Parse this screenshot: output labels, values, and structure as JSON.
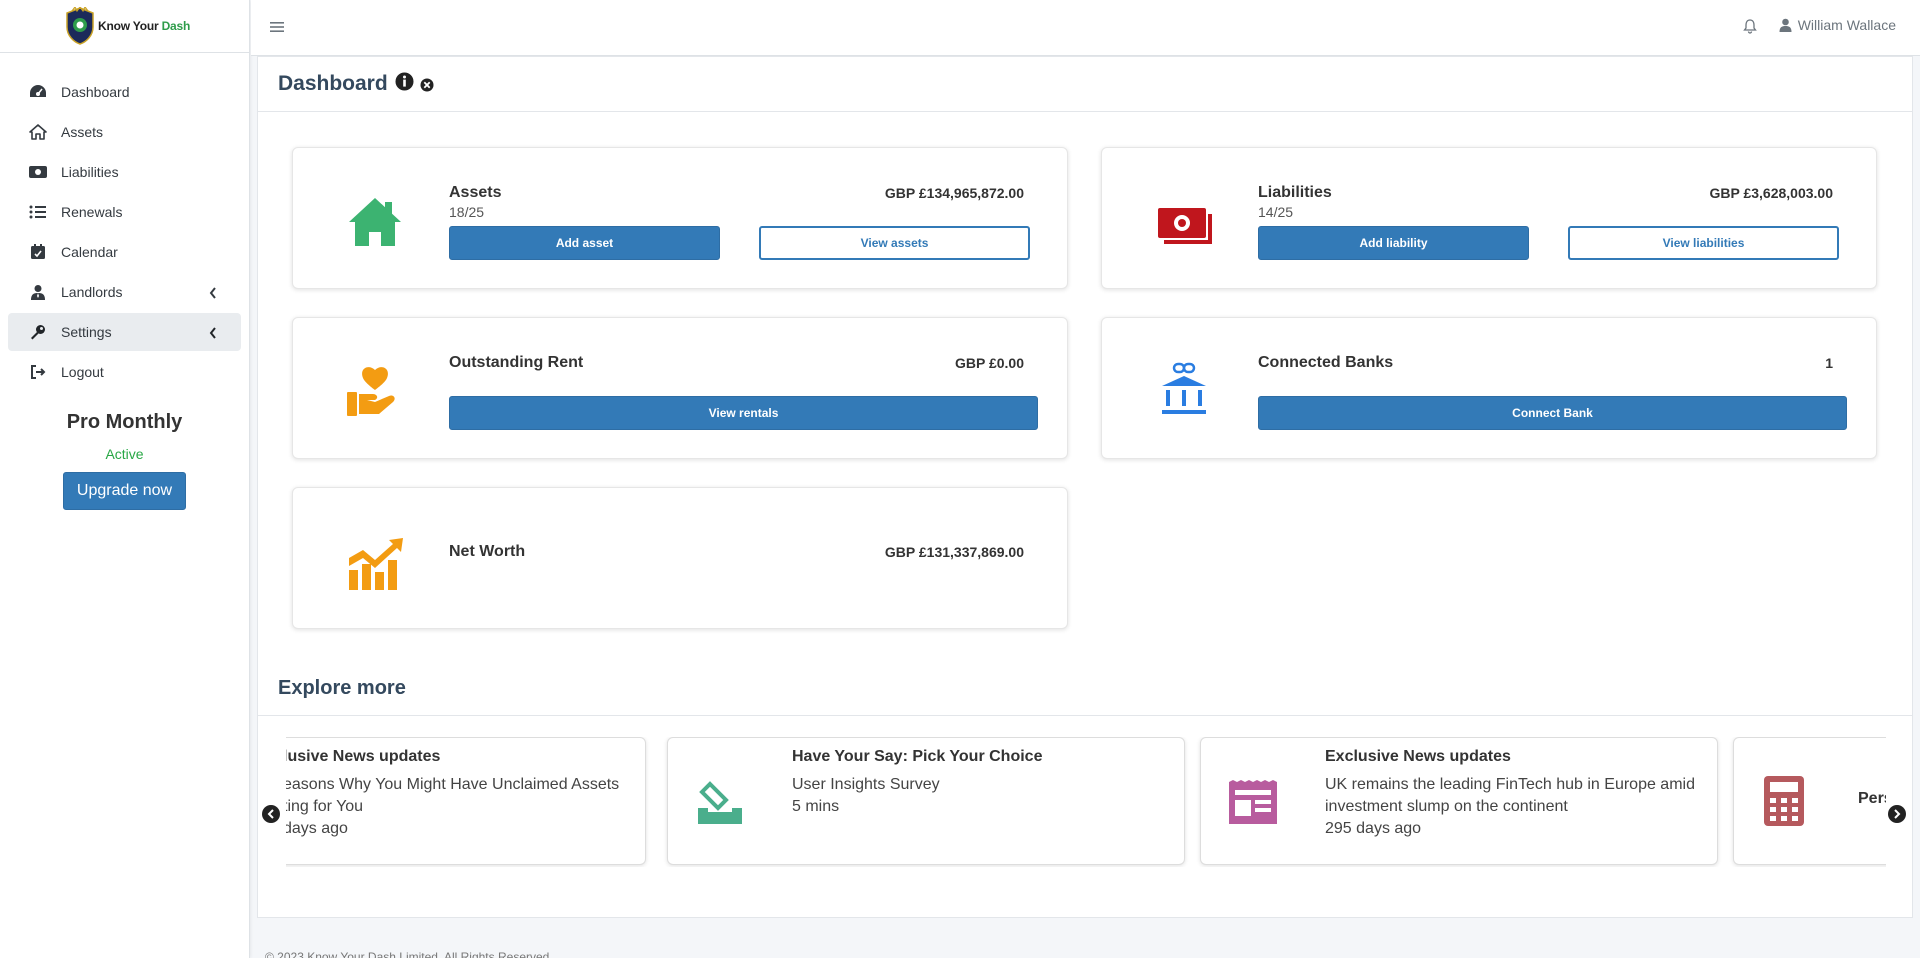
{
  "brand": {
    "name_part1": "Know Your ",
    "name_part2": "Dash"
  },
  "sidebar": {
    "items": [
      {
        "label": "Dashboard",
        "icon": "gauge-icon"
      },
      {
        "label": "Assets",
        "icon": "home-icon"
      },
      {
        "label": "Liabilities",
        "icon": "money-icon"
      },
      {
        "label": "Renewals",
        "icon": "list-icon"
      },
      {
        "label": "Calendar",
        "icon": "calendar-icon"
      },
      {
        "label": "Landlords",
        "icon": "user-tie-icon"
      },
      {
        "label": "Settings",
        "icon": "wrench-icon"
      },
      {
        "label": "Logout",
        "icon": "logout-icon"
      }
    ],
    "plan": {
      "name": "Pro Monthly",
      "status": "Active",
      "upgrade_label": "Upgrade now"
    }
  },
  "header": {
    "user_name": "William Wallace"
  },
  "page": {
    "title": "Dashboard"
  },
  "cards": {
    "assets": {
      "title": "Assets",
      "count": "18/25",
      "amount": "GBP £134,965,872.00",
      "primary_label": "Add asset",
      "secondary_label": "View assets"
    },
    "liabilities": {
      "title": "Liabilities",
      "count": "14/25",
      "amount": "GBP £3,628,003.00",
      "primary_label": "Add liability",
      "secondary_label": "View liabilities"
    },
    "rent": {
      "title": "Outstanding Rent",
      "amount": "GBP £0.00",
      "primary_label": "View rentals"
    },
    "banks": {
      "title": "Connected Banks",
      "amount": "1",
      "primary_label": "Connect Bank"
    },
    "networth": {
      "title": "Net Worth",
      "amount": "GBP £131,337,869.00"
    }
  },
  "colors": {
    "primary": "#337ab7",
    "green": "#3cb371",
    "red": "#c0161d",
    "orange": "#f39c12",
    "blue": "#2a7de1",
    "purple": "#b85c9e",
    "rose": "#b5595d"
  },
  "explore": {
    "title": "Explore more",
    "items": [
      {
        "title": "lusive News updates",
        "line1": "easons Why You Might Have Unclaimed Assets",
        "line2": "ting for You",
        "line3": "days ago"
      },
      {
        "title": "Have Your Say: Pick Your Choice",
        "line1": "User Insights Survey",
        "line2": "5 mins"
      },
      {
        "title": "Exclusive News updates",
        "line1": "UK remains the leading FinTech hub in Europe amid",
        "line2": "investment slump on the continent",
        "line3": "295 days ago"
      },
      {
        "title": "Pers"
      }
    ]
  },
  "footer": {
    "text": "© 2023 Know Your Dash Limited. All Rights Reserved"
  }
}
